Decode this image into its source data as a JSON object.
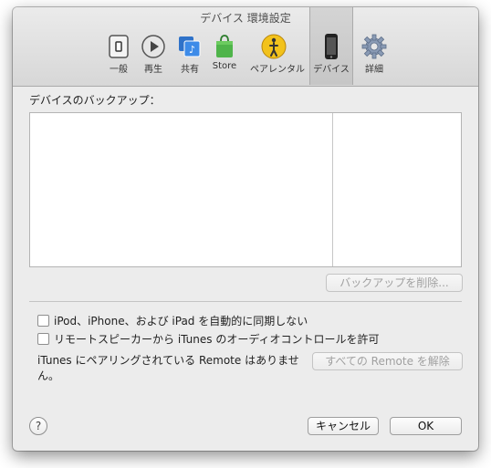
{
  "window": {
    "title": "デバイス 環境設定"
  },
  "toolbar": {
    "items": [
      {
        "label": "一般",
        "icon": "general-switch-icon"
      },
      {
        "label": "再生",
        "icon": "play-icon"
      },
      {
        "label": "共有",
        "icon": "sharing-icon"
      },
      {
        "label": "Store",
        "icon": "store-bag-icon"
      },
      {
        "label": "ペアレンタル",
        "icon": "parental-icon"
      },
      {
        "label": "デバイス",
        "icon": "iphone-icon",
        "selected": true
      },
      {
        "label": "詳細",
        "icon": "gear-icon"
      }
    ]
  },
  "backup": {
    "section_label": "デバイスのバックアップ：",
    "rows": [],
    "delete_button": "バックアップを削除..."
  },
  "options": {
    "prevent_sync_label": "iPod、iPhone、および iPad を自動的に同期しない",
    "prevent_sync_checked": false,
    "allow_remote_label": "リモートスピーカーから iTunes のオーディオコントロールを許可",
    "allow_remote_checked": false
  },
  "remote": {
    "text": "iTunes にペアリングされている Remote はありません。",
    "unpair_button": "すべての Remote を解除"
  },
  "footer": {
    "help": "?",
    "cancel_button": "キャンセル",
    "ok_button": "OK"
  }
}
